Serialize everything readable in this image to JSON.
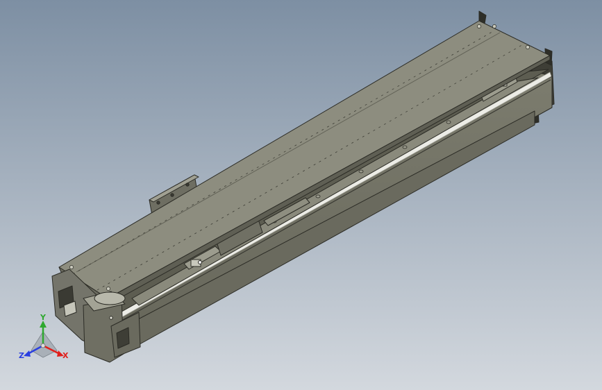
{
  "viewport": {
    "background_top": "#7d8fa3",
    "background_bottom": "#d3d8de"
  },
  "model": {
    "body_color": "#757567",
    "top_color": "#8c8c7e",
    "dark_color": "#4f4f45",
    "rail_color": "#e6e6e0"
  },
  "triad": {
    "x_label": "X",
    "y_label": "Y",
    "z_label": "Z",
    "x_color": "#e0201c",
    "y_color": "#2fa82f",
    "z_color": "#2a3fe0"
  }
}
